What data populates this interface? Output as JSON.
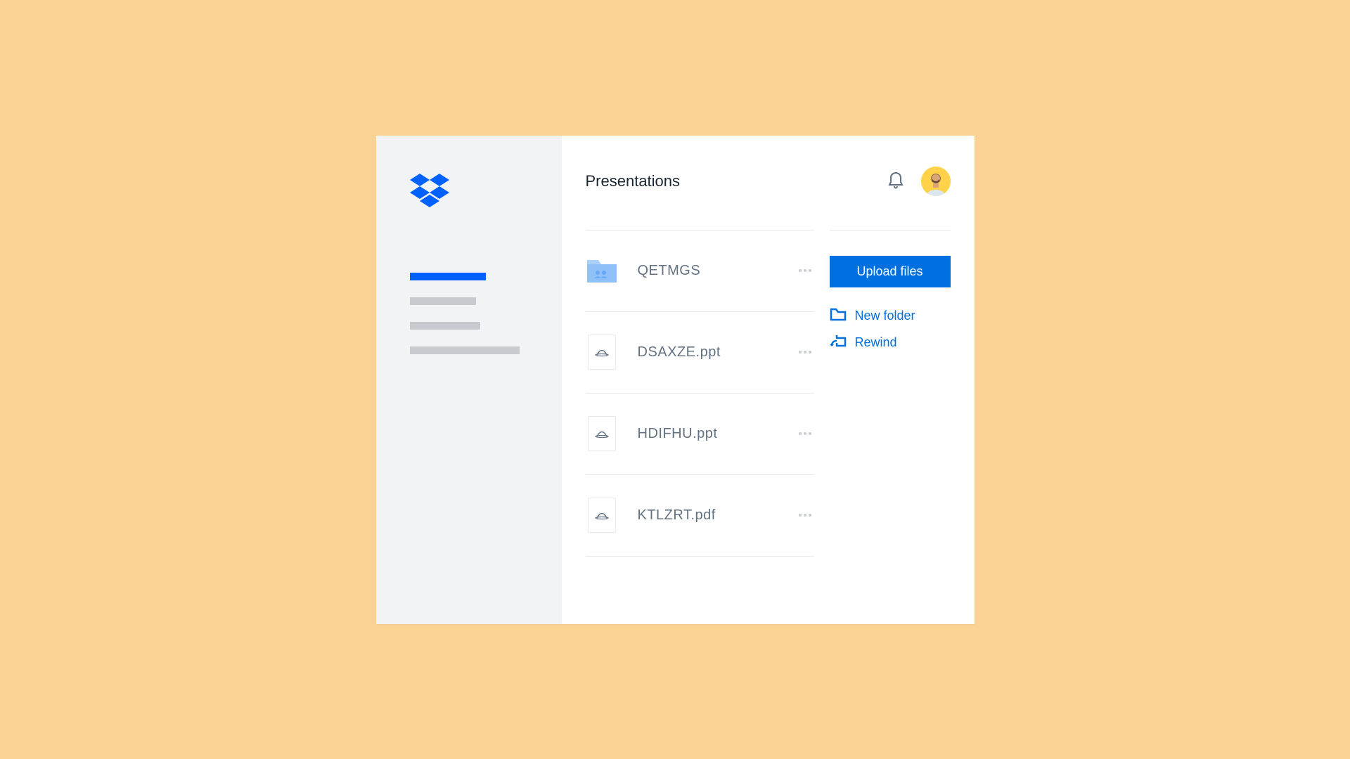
{
  "page": {
    "title": "Presentations"
  },
  "files": [
    {
      "name": "QETMGS",
      "type": "folder"
    },
    {
      "name": "DSAXZE.ppt",
      "type": "doc"
    },
    {
      "name": "HDIFHU.ppt",
      "type": "doc"
    },
    {
      "name": "KTLZRT.pdf",
      "type": "doc"
    }
  ],
  "actions": {
    "upload": "Upload files",
    "new_folder": "New folder",
    "rewind": "Rewind"
  },
  "colors": {
    "primary": "#0070e0",
    "brand": "#0061ff",
    "text_muted": "#637282"
  }
}
